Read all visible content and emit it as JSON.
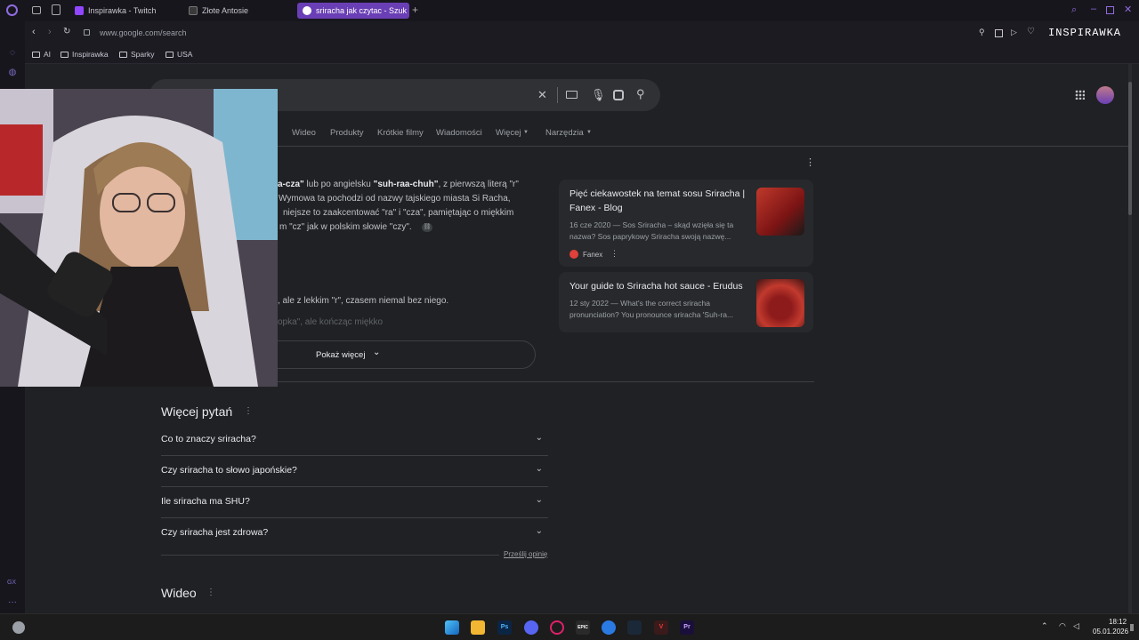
{
  "tabs": [
    {
      "label": "Inspirawka - Twitch"
    },
    {
      "label": "Złote Antosie"
    },
    {
      "label": "sriracha jak czytac - Szuk",
      "active": true
    }
  ],
  "address": {
    "url": "www.google.com/search"
  },
  "bookmarks": [
    "AI",
    "Inspirawka",
    "Sparky",
    "USA"
  ],
  "overlay_text": "INSPIRAWKA",
  "sidebar_label": "GX",
  "search_tabs": [
    "Wideo",
    "Produkty",
    "Krótkie filmy",
    "Wiadomości",
    "Więcej",
    "Narzędzia"
  ],
  "snippet": {
    "line1_a": "a-cza\"",
    "line1_b": " lub po angielsku ",
    "line1_c": "\"suh-raa-chuh\"",
    "line1_d": ", z pierwszą literą \"r\"",
    "line2": "Wymowa ta pochodzi od nazwy tajskiego miasta Si Racha,",
    "line3": "niejsze to zaakcentować \"ra\" i \"cza\", pamiętając o miękkim",
    "line4": "m \"cz\" jak w polskim słowie \"czy\".",
    "line5": ", ale z lekkim \"r\", czasem niemal bez niego.",
    "line6": "opka\", ale kończąc miękko",
    "show_more": "Pokaż więcej"
  },
  "cards": [
    {
      "title": "Pięć ciekawostek na temat sosu Sriracha | Fanex - Blog",
      "text": "16 cze 2020 — Sos Sriracha – skąd wzięła się ta nazwa? Sos paprykowy Sriracha swoją nazwę...",
      "source": "Fanex"
    },
    {
      "title": "Your guide to Sriracha hot sauce - Erudus",
      "text": "12 sty 2022 — What's the correct sriracha pronunciation? You pronounce sriracha 'Suh-ra...",
      "source": ""
    }
  ],
  "paa": {
    "heading": "Więcej pytań",
    "questions": [
      "Co to znaczy sriracha?",
      "Czy sriracha to słowo japońskie?",
      "Ile sriracha ma SHU?",
      "Czy sriracha jest zdrowa?"
    ],
    "feedback": "Prześlij opinię"
  },
  "video_heading": "Wideo",
  "taskbar": {
    "time": "18:12",
    "date": "05.01.2026"
  },
  "colors": {
    "accent": "#6a3fb5",
    "page_bg": "#202124",
    "text": "#bdc1c6",
    "heading": "#e8eaed"
  }
}
